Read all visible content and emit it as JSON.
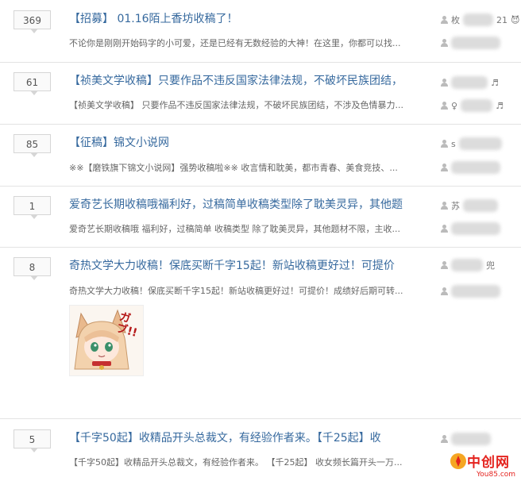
{
  "threads": [
    {
      "count": "369",
      "title": "【招募】 01.16陌上香坊收稿了！",
      "excerpt": "不论你是刚刚开始码字的小可爱，还是已经有无数经验的大神！在这里，你都可以找...",
      "author_visible": "枚",
      "author_tail": "21",
      "author_emoji": "😈"
    },
    {
      "count": "61",
      "title": "【祯美文学收稿】只要作品不违反国家法律法规，不破坏民族团结，",
      "excerpt": "【祯美文学收稿】 只要作品不违反国家法律法规，不破坏民族团结，不涉及色情暴力...",
      "author_tail": "♬",
      "reply_prefix": "♀",
      "reply_tail": "♬"
    },
    {
      "count": "85",
      "title": "【征稿】锦文小说网",
      "excerpt": "※※【磨铁旗下锦文小说网】强势收稿啦※※ 收言情和耽美，都市青春、美食竞技、...",
      "author_visible": "s"
    },
    {
      "count": "1",
      "title": "爱奇艺长期收稿哦福利好，过稿简单收稿类型除了耽美灵异，其他题",
      "excerpt": "爱奇艺长期收稿哦 福利好，过稿简单 收稿类型 除了耽美灵异，其他题材不限，主收...",
      "author_visible": "苏"
    },
    {
      "count": "8",
      "title": "奇热文学大力收稿！保底买断千字15起！新站收稿更好过！可提价",
      "excerpt": "奇热文学大力收稿！保底买断千字15起！新站收稿更好过！可提价！成绩好后期可转...",
      "author_tail": "兜",
      "sticker_text": "ガブ!!"
    },
    {
      "count": "5",
      "title": "【千字50起】收精品开头总裁文，有经验作者来。【千25起】收",
      "excerpt": "【千字50起】收精品开头总裁文，有经验作者来。 【千25起】 收女频长篇开头一万..."
    }
  ],
  "watermark": {
    "text": "中创网",
    "sub": "You85.com"
  },
  "colors": {
    "title": "#36699e",
    "excerpt": "#666666",
    "count_border": "#d6d6d6",
    "divider": "#e3e3e3",
    "watermark": "#e4231e"
  }
}
